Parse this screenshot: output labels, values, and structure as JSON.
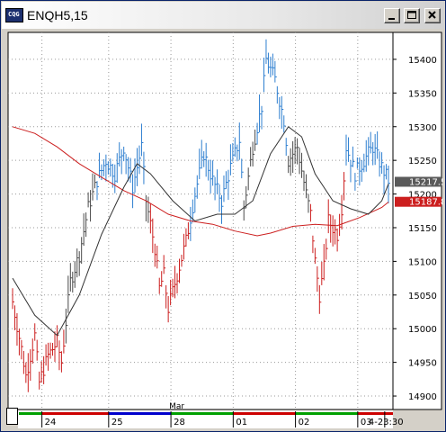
{
  "window": {
    "title": "ENQH5,15",
    "app_icon_text": "CQG",
    "buttons": {
      "minimize": "minimize-icon",
      "maximize": "maximize-icon",
      "close": "close-icon"
    }
  },
  "colors": {
    "up": "#2e7fd0",
    "down": "#cc1f1f",
    "neutral": "#4a4a4a",
    "ma_slow": "#cc1f1f",
    "ma_fast": "#333333",
    "plot_bg": "#ffffff",
    "grid": "#9a9a9a"
  },
  "axis": {
    "price_labels": [
      "15400",
      "15350",
      "15300",
      "15250",
      "15200",
      "15150",
      "15100",
      "15050",
      "15000",
      "14950",
      "14900"
    ],
    "date_labels": [
      "24",
      "25",
      "28",
      "01",
      "02",
      "03",
      "4-23:30"
    ],
    "month_label": "Mar"
  },
  "markers": {
    "last_price": "15217.5",
    "ma_value": "15187.8"
  },
  "chart_data": {
    "type": "bar",
    "title": "ENQH5,15",
    "ylim": [
      14880,
      15440
    ],
    "y_ticks": [
      15400,
      15350,
      15300,
      15250,
      15200,
      15150,
      15100,
      15050,
      15000,
      14950,
      14900
    ],
    "x_sessions": [
      "24",
      "25",
      "28",
      "01",
      "02",
      "03",
      "4-23:30"
    ],
    "grid": true,
    "series": [
      {
        "name": "",
        "kind": "price_bars",
        "anchors": [
          {
            "i": 0,
            "close": 15040
          },
          {
            "i": 4,
            "close": 14970
          },
          {
            "i": 6,
            "close": 14930
          },
          {
            "i": 10,
            "close": 14990
          },
          {
            "i": 12,
            "close": 14920
          },
          {
            "i": 16,
            "close": 14960
          },
          {
            "i": 20,
            "close": 14980
          },
          {
            "i": 22,
            "close": 14950
          },
          {
            "i": 26,
            "close": 15070
          },
          {
            "i": 30,
            "close": 15110
          },
          {
            "i": 34,
            "close": 15180
          },
          {
            "i": 38,
            "close": 15220
          },
          {
            "i": 42,
            "close": 15250
          },
          {
            "i": 46,
            "close": 15230
          },
          {
            "i": 50,
            "close": 15270
          },
          {
            "i": 54,
            "close": 15210
          },
          {
            "i": 58,
            "close": 15270
          },
          {
            "i": 60,
            "close": 15190
          },
          {
            "i": 64,
            "close": 15120
          },
          {
            "i": 66,
            "close": 15060
          },
          {
            "i": 68,
            "close": 15080
          },
          {
            "i": 70,
            "close": 15030
          },
          {
            "i": 74,
            "close": 15080
          },
          {
            "i": 78,
            "close": 15130
          },
          {
            "i": 82,
            "close": 15200
          },
          {
            "i": 86,
            "close": 15260
          },
          {
            "i": 90,
            "close": 15220
          },
          {
            "i": 94,
            "close": 15190
          },
          {
            "i": 98,
            "close": 15240
          },
          {
            "i": 102,
            "close": 15280
          },
          {
            "i": 104,
            "close": 15180
          },
          {
            "i": 108,
            "close": 15270
          },
          {
            "i": 112,
            "close": 15330
          },
          {
            "i": 114,
            "close": 15400
          },
          {
            "i": 118,
            "close": 15370
          },
          {
            "i": 122,
            "close": 15310
          },
          {
            "i": 124,
            "close": 15250
          },
          {
            "i": 128,
            "close": 15270
          },
          {
            "i": 132,
            "close": 15200
          },
          {
            "i": 134,
            "close": 15170
          },
          {
            "i": 136,
            "close": 15100
          },
          {
            "i": 138,
            "close": 15050
          },
          {
            "i": 140,
            "close": 15090
          },
          {
            "i": 142,
            "close": 15160
          },
          {
            "i": 146,
            "close": 15140
          },
          {
            "i": 148,
            "close": 15180
          },
          {
            "i": 150,
            "close": 15270
          },
          {
            "i": 154,
            "close": 15230
          },
          {
            "i": 158,
            "close": 15250
          },
          {
            "i": 162,
            "close": 15270
          },
          {
            "i": 166,
            "close": 15240
          },
          {
            "i": 169,
            "close": 15220
          }
        ]
      },
      {
        "name": "",
        "kind": "moving_average_slow",
        "points": [
          {
            "i": 0,
            "v": 15300
          },
          {
            "i": 10,
            "v": 15290
          },
          {
            "i": 20,
            "v": 15270
          },
          {
            "i": 30,
            "v": 15245
          },
          {
            "i": 40,
            "v": 15225
          },
          {
            "i": 50,
            "v": 15205
          },
          {
            "i": 60,
            "v": 15190
          },
          {
            "i": 70,
            "v": 15170
          },
          {
            "i": 80,
            "v": 15160
          },
          {
            "i": 90,
            "v": 15155
          },
          {
            "i": 100,
            "v": 15145
          },
          {
            "i": 110,
            "v": 15138
          },
          {
            "i": 116,
            "v": 15142
          },
          {
            "i": 126,
            "v": 15152
          },
          {
            "i": 136,
            "v": 15155
          },
          {
            "i": 146,
            "v": 15153
          },
          {
            "i": 156,
            "v": 15165
          },
          {
            "i": 166,
            "v": 15180
          },
          {
            "i": 169,
            "v": 15188
          }
        ]
      },
      {
        "name": "",
        "kind": "moving_average_fast",
        "points": [
          {
            "i": 0,
            "v": 15075
          },
          {
            "i": 10,
            "v": 15020
          },
          {
            "i": 20,
            "v": 14990
          },
          {
            "i": 30,
            "v": 15050
          },
          {
            "i": 40,
            "v": 15140
          },
          {
            "i": 50,
            "v": 15210
          },
          {
            "i": 56,
            "v": 15245
          },
          {
            "i": 62,
            "v": 15230
          },
          {
            "i": 72,
            "v": 15190
          },
          {
            "i": 82,
            "v": 15160
          },
          {
            "i": 92,
            "v": 15170
          },
          {
            "i": 100,
            "v": 15170
          },
          {
            "i": 108,
            "v": 15190
          },
          {
            "i": 116,
            "v": 15260
          },
          {
            "i": 124,
            "v": 15300
          },
          {
            "i": 130,
            "v": 15285
          },
          {
            "i": 136,
            "v": 15230
          },
          {
            "i": 144,
            "v": 15190
          },
          {
            "i": 152,
            "v": 15178
          },
          {
            "i": 160,
            "v": 15170
          },
          {
            "i": 166,
            "v": 15190
          },
          {
            "i": 169,
            "v": 15215
          }
        ]
      }
    ]
  }
}
